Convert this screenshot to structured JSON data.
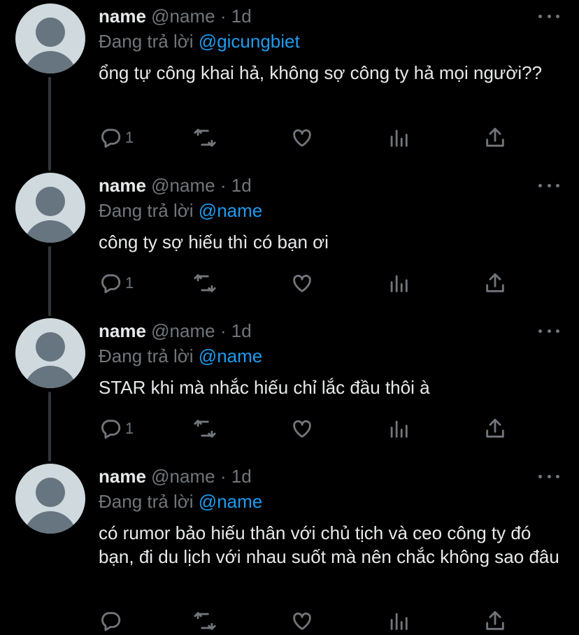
{
  "tweets": [
    {
      "name": "name",
      "handle": "@name",
      "separator": "·",
      "time": "1d",
      "reply_prefix": "Đang trả lời",
      "reply_to": "@gicungbiet",
      "text": "ổng tự công khai hả, không sợ công ty hả mọi người??",
      "reply_count": "1"
    },
    {
      "name": "name",
      "handle": "@name",
      "separator": "·",
      "time": "1d",
      "reply_prefix": "Đang trả lời",
      "reply_to": "@name",
      "text": "công ty sợ hiếu thì có bạn ơi",
      "reply_count": "1"
    },
    {
      "name": "name",
      "handle": "@name",
      "separator": "·",
      "time": "1d",
      "reply_prefix": "Đang trả lời",
      "reply_to": "@name",
      "text": "STAR khi mà nhắc hiếu chỉ lắc đầu thôi à",
      "reply_count": "1"
    },
    {
      "name": "name",
      "handle": "@name",
      "separator": "·",
      "time": "1d",
      "reply_prefix": "Đang trả lời",
      "reply_to": "@name",
      "text": "có rumor bảo hiếu thân với chủ tịch và ceo công ty đó bạn, đi du lịch với nhau suốt mà nên chắc không sao đâu",
      "reply_count": ""
    }
  ],
  "icons": {
    "avatar": "default-avatar-icon",
    "more": "more-horizontal-icon",
    "reply": "reply-icon",
    "retweet": "retweet-icon",
    "like": "heart-icon",
    "analytics": "analytics-icon",
    "share": "share-icon"
  },
  "colors": {
    "background": "#000000",
    "text": "#e7e9ea",
    "muted": "#71767b",
    "mention": "#1d9bf0",
    "thread_line": "#333639",
    "avatar_bg": "#cfd9de",
    "avatar_fg": "#66757f"
  }
}
